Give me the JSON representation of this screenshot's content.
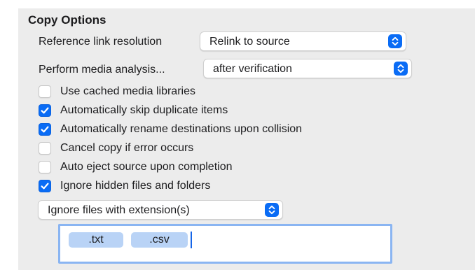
{
  "section_title": "Copy Options",
  "reference_link": {
    "label": "Reference link resolution",
    "value": "Relink to source"
  },
  "media_analysis": {
    "label": "Perform media analysis...",
    "value": "after verification"
  },
  "options": [
    {
      "label": "Use cached media libraries",
      "checked": false
    },
    {
      "label": "Automatically skip duplicate items",
      "checked": true
    },
    {
      "label": "Automatically rename destinations upon collision",
      "checked": true
    },
    {
      "label": "Cancel copy if error occurs",
      "checked": false
    },
    {
      "label": "Auto eject source upon completion",
      "checked": false
    },
    {
      "label": "Ignore hidden files and folders",
      "checked": true
    }
  ],
  "extension_filter": {
    "value": "Ignore files with extension(s)",
    "tokens": [
      ".txt",
      ".csv"
    ]
  },
  "colors": {
    "accent": "#0a6cf5",
    "panel_background": "#ececec",
    "token_background": "#b9d3f6",
    "focus_ring": "#8ab5f2"
  },
  "icons": {
    "popup_stepper": "chevron-up-down-icon",
    "checkbox_mark": "checkmark-icon"
  }
}
